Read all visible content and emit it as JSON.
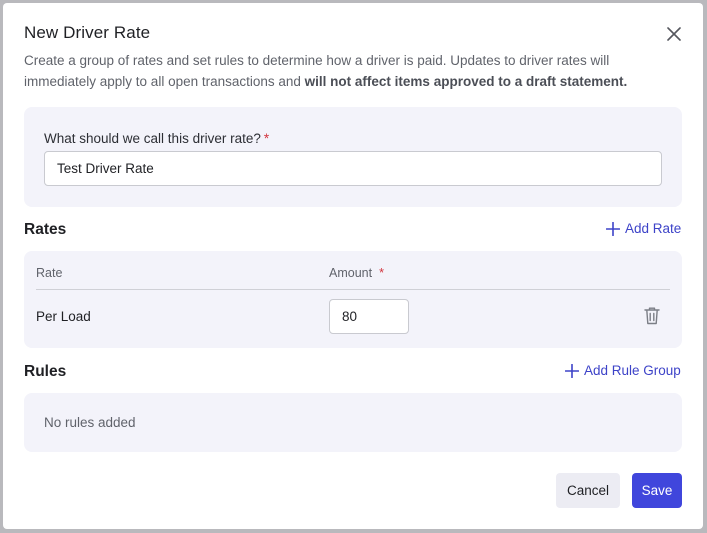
{
  "dialog": {
    "title": "New Driver Rate",
    "description_plain": "Create a group of rates and set rules to determine how a driver is paid. Updates to driver rates will immediately apply to all open transactions and ",
    "description_bold": "will not affect items approved to a draft statement."
  },
  "name_field": {
    "label": "What should we call this driver rate?",
    "required_mark": "*",
    "value": "Test Driver Rate"
  },
  "rates": {
    "title": "Rates",
    "add_label": "Add Rate",
    "columns": {
      "rate": "Rate",
      "amount": "Amount",
      "required_mark": "*"
    },
    "rows": [
      {
        "rate": "Per Load",
        "amount": "80"
      }
    ]
  },
  "rules": {
    "title": "Rules",
    "add_label": "Add Rule Group",
    "empty_text": "No rules added"
  },
  "actions": {
    "cancel": "Cancel",
    "save": "Save"
  },
  "icons": {
    "close": "close-icon",
    "add": "plus-icon",
    "delete": "trash-icon"
  },
  "colors": {
    "accent": "#4046dc",
    "link": "#3d43c8",
    "required": "#d2343d",
    "panel": "#f3f3fa"
  }
}
